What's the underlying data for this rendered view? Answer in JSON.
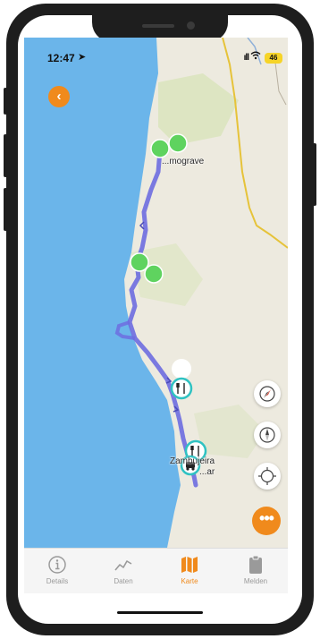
{
  "status_bar": {
    "time": "12:47",
    "location_arrow": "➤",
    "signal": "ıll",
    "wifi": "wifi-icon",
    "battery": "46"
  },
  "map": {
    "labels": {
      "top_town": "...mograve",
      "bottom_town_line1": "Zambujeira",
      "bottom_town_line2": "...ar"
    },
    "colors": {
      "sea": "#6bb5ea",
      "land": "#edeadf",
      "green_land": "#dfe6c5",
      "route": "#7b7be0",
      "road": "#e6c33a",
      "marker_green": "#5fd35f",
      "marker_teal": "#2fc2c2"
    }
  },
  "controls": {
    "back_icon": "chevron-left-icon",
    "back_glyph": "‹",
    "more_glyph": "•••",
    "compass_icon": "compass-icon",
    "north_icon": "north-arrow-icon",
    "locate_icon": "locate-icon"
  },
  "tabbar": {
    "items": [
      {
        "label": "Details",
        "icon": "info-icon",
        "active": false
      },
      {
        "label": "Daten",
        "icon": "chart-line-icon",
        "active": false
      },
      {
        "label": "Karte",
        "icon": "map-icon",
        "active": true
      },
      {
        "label": "Melden",
        "icon": "clipboard-icon",
        "active": false
      }
    ]
  }
}
